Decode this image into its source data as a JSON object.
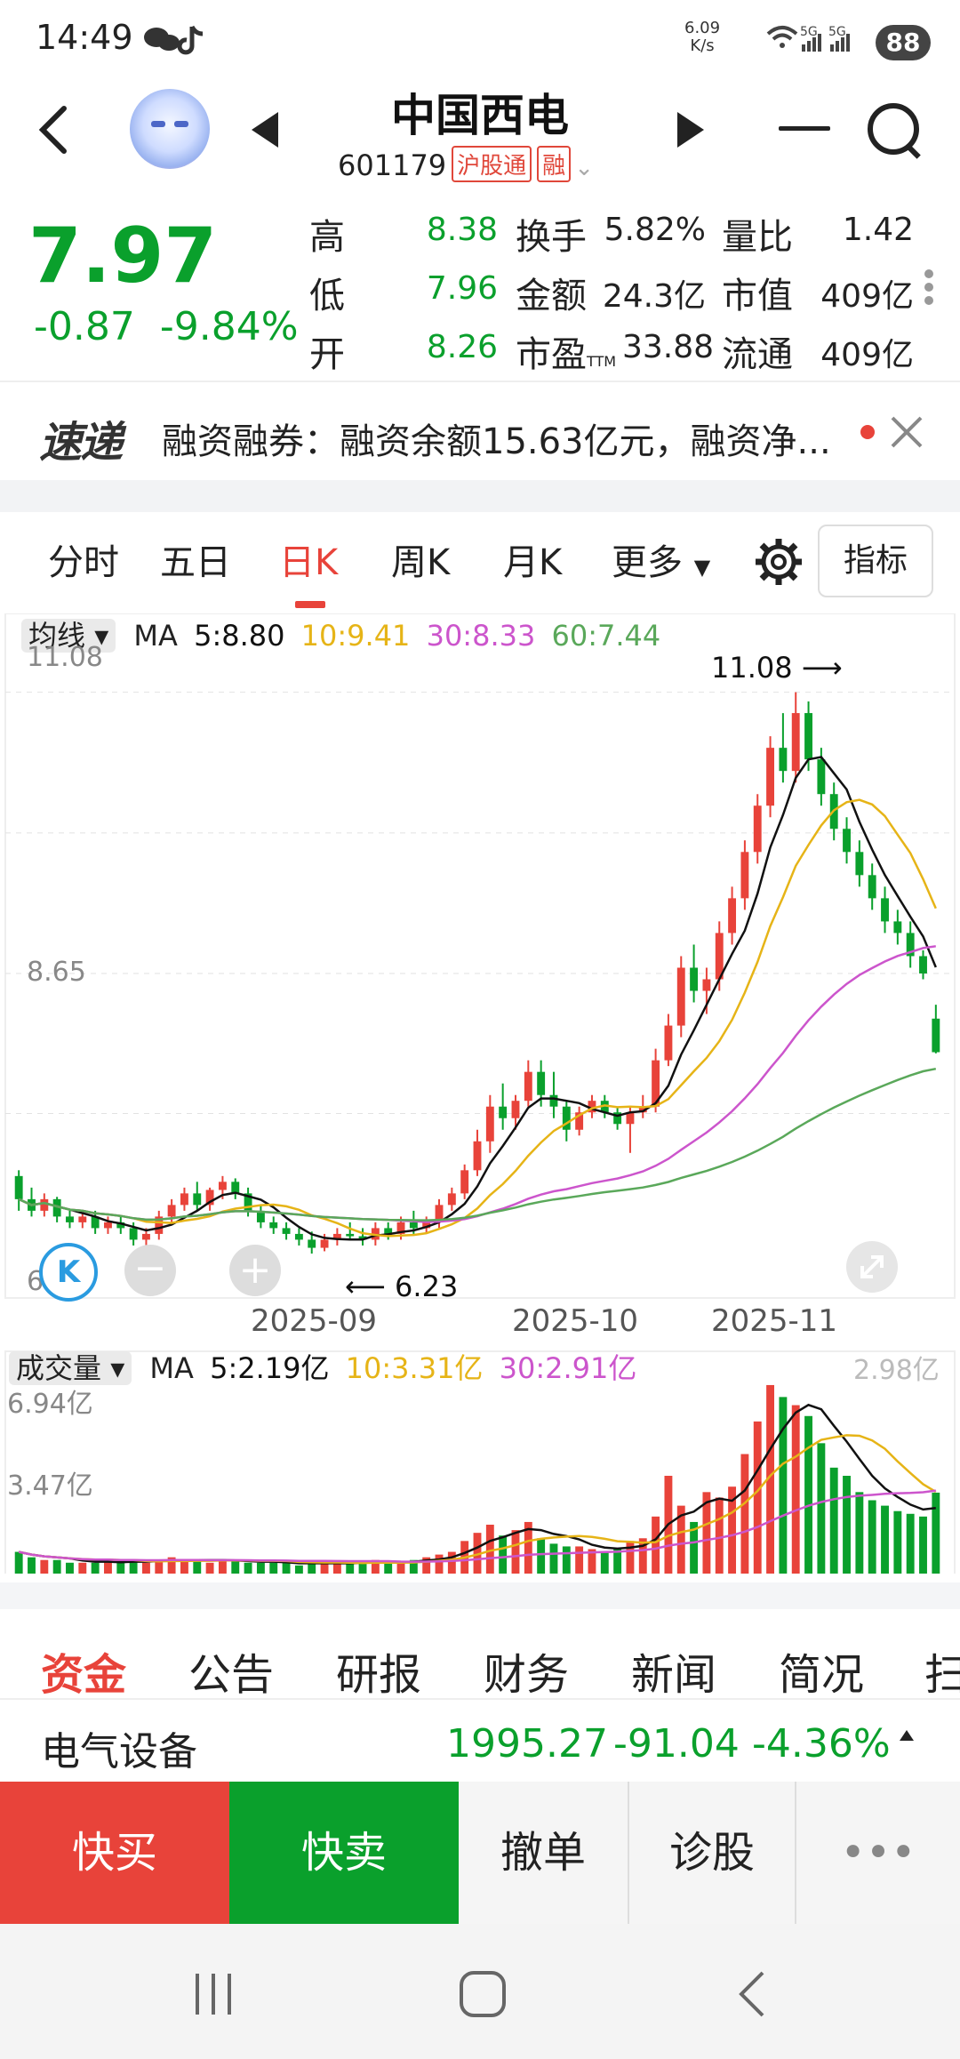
{
  "status_bar": {
    "time": "14:49",
    "net_speed": "6.09",
    "net_unit": "K/s",
    "sig1": "5G",
    "sig2": "5G",
    "battery": "88"
  },
  "header": {
    "title": "中国西电",
    "code": "601179",
    "tag1": "沪股通",
    "tag2": "融"
  },
  "quote": {
    "price": "7.97",
    "change": "-0.87",
    "change_pct": "-9.84%",
    "rows": [
      {
        "l1": "高",
        "v1": "8.38",
        "l2": "换手",
        "v2": "5.82%",
        "l3": "量比",
        "v3": "1.42"
      },
      {
        "l1": "低",
        "v1": "7.96",
        "l2": "金额",
        "v2": "24.3亿",
        "l3": "市值",
        "v3": "409亿"
      },
      {
        "l1": "开",
        "v1": "8.26",
        "l2": "市盈",
        "l2sub": "TTM",
        "v2": "33.88",
        "l3": "流通",
        "v3": "409亿"
      }
    ]
  },
  "ticker": {
    "logo": "速递",
    "text": "融资融券：融资余额15.63亿元，融资净..."
  },
  "chart_tabs": {
    "items": [
      "分时",
      "五日",
      "日K",
      "周K",
      "月K",
      "更多"
    ],
    "active": "日K",
    "indicator": "指标"
  },
  "ma_legend": {
    "selector": "均线",
    "ma": "MA",
    "ma5": "5:8.80",
    "ma10": "10:9.41",
    "ma30": "30:8.33",
    "ma60": "60:7.44"
  },
  "vol_legend": {
    "selector": "成交量",
    "ma": "MA",
    "ma5": "5:2.19亿",
    "ma10": "10:3.31亿",
    "ma30": "30:2.91亿",
    "right_val": "2.98亿"
  },
  "axis": {
    "y_high": "11.08",
    "y_mid": "8.65",
    "y_low": "6.23",
    "vol_high": "6.94亿",
    "vol_mid": "3.47亿",
    "max_label": "11.08",
    "min_label": "6.23",
    "dates": [
      "2025-09",
      "2025-10",
      "2025-11"
    ]
  },
  "bottom_tabs": {
    "items": [
      "资金",
      "公告",
      "研报",
      "财务",
      "新闻",
      "简况",
      "扫"
    ],
    "active": "资金"
  },
  "sector": {
    "name": "电气设备",
    "value": "1995.27",
    "change": "-91.04",
    "pct": "-4.36%"
  },
  "actions": {
    "buy": "快买",
    "sell": "快卖",
    "cancel": "撤单",
    "diagnose": "诊股",
    "more": "•••"
  },
  "colors": {
    "up": "#e8433a",
    "down": "#0aa02c",
    "ma5": "#111111",
    "ma10": "#e6b417",
    "ma30": "#cc55cc",
    "ma60": "#5aa85a"
  },
  "chart_data": {
    "type": "candlestick",
    "y_range": [
      6.23,
      11.08
    ],
    "x_ticks": [
      "2025-09",
      "2025-10",
      "2025-11"
    ],
    "candles": [
      [
        6.9,
        6.95,
        6.6,
        6.7
      ],
      [
        6.7,
        6.8,
        6.55,
        6.6
      ],
      [
        6.6,
        6.75,
        6.55,
        6.7
      ],
      [
        6.7,
        6.72,
        6.5,
        6.55
      ],
      [
        6.55,
        6.6,
        6.45,
        6.5
      ],
      [
        6.5,
        6.6,
        6.45,
        6.55
      ],
      [
        6.55,
        6.6,
        6.4,
        6.45
      ],
      [
        6.45,
        6.55,
        6.4,
        6.5
      ],
      [
        6.5,
        6.55,
        6.4,
        6.45
      ],
      [
        6.45,
        6.5,
        6.3,
        6.35
      ],
      [
        6.35,
        6.45,
        6.3,
        6.4
      ],
      [
        6.4,
        6.6,
        6.35,
        6.55
      ],
      [
        6.55,
        6.7,
        6.5,
        6.65
      ],
      [
        6.65,
        6.8,
        6.6,
        6.75
      ],
      [
        6.75,
        6.85,
        6.6,
        6.65
      ],
      [
        6.65,
        6.8,
        6.6,
        6.78
      ],
      [
        6.78,
        6.9,
        6.7,
        6.85
      ],
      [
        6.85,
        6.88,
        6.7,
        6.75
      ],
      [
        6.75,
        6.8,
        6.55,
        6.6
      ],
      [
        6.6,
        6.65,
        6.45,
        6.5
      ],
      [
        6.5,
        6.55,
        6.4,
        6.45
      ],
      [
        6.45,
        6.5,
        6.35,
        6.4
      ],
      [
        6.4,
        6.45,
        6.3,
        6.35
      ],
      [
        6.35,
        6.42,
        6.23,
        6.28
      ],
      [
        6.28,
        6.4,
        6.25,
        6.35
      ],
      [
        6.35,
        6.45,
        6.3,
        6.4
      ],
      [
        6.4,
        6.5,
        6.35,
        6.38
      ],
      [
        6.38,
        6.45,
        6.3,
        6.35
      ],
      [
        6.35,
        6.5,
        6.3,
        6.45
      ],
      [
        6.45,
        6.5,
        6.35,
        6.4
      ],
      [
        6.4,
        6.55,
        6.35,
        6.5
      ],
      [
        6.5,
        6.6,
        6.4,
        6.45
      ],
      [
        6.45,
        6.55,
        6.4,
        6.5
      ],
      [
        6.5,
        6.7,
        6.45,
        6.65
      ],
      [
        6.65,
        6.8,
        6.6,
        6.75
      ],
      [
        6.75,
        7.0,
        6.7,
        6.95
      ],
      [
        6.95,
        7.3,
        6.9,
        7.2
      ],
      [
        7.2,
        7.6,
        7.1,
        7.5
      ],
      [
        7.5,
        7.7,
        7.3,
        7.4
      ],
      [
        7.4,
        7.6,
        7.3,
        7.55
      ],
      [
        7.55,
        7.9,
        7.5,
        7.8
      ],
      [
        7.8,
        7.9,
        7.5,
        7.6
      ],
      [
        7.6,
        7.8,
        7.4,
        7.5
      ],
      [
        7.5,
        7.55,
        7.2,
        7.3
      ],
      [
        7.3,
        7.5,
        7.25,
        7.45
      ],
      [
        7.45,
        7.6,
        7.4,
        7.55
      ],
      [
        7.55,
        7.6,
        7.4,
        7.45
      ],
      [
        7.45,
        7.5,
        7.3,
        7.35
      ],
      [
        7.35,
        7.5,
        7.1,
        7.45
      ],
      [
        7.45,
        7.6,
        7.4,
        7.5
      ],
      [
        7.5,
        8.0,
        7.45,
        7.9
      ],
      [
        7.9,
        8.3,
        7.85,
        8.2
      ],
      [
        8.2,
        8.8,
        8.1,
        8.7
      ],
      [
        8.7,
        8.9,
        8.4,
        8.5
      ],
      [
        8.5,
        8.7,
        8.3,
        8.6
      ],
      [
        8.6,
        9.1,
        8.5,
        9.0
      ],
      [
        9.0,
        9.4,
        8.9,
        9.3
      ],
      [
        9.3,
        9.8,
        9.2,
        9.7
      ],
      [
        9.7,
        10.2,
        9.6,
        10.1
      ],
      [
        10.1,
        10.7,
        10.0,
        10.6
      ],
      [
        10.6,
        10.9,
        10.3,
        10.4
      ],
      [
        10.4,
        11.08,
        10.3,
        10.9
      ],
      [
        10.9,
        11.0,
        10.4,
        10.5
      ],
      [
        10.5,
        10.6,
        10.1,
        10.2
      ],
      [
        10.2,
        10.3,
        9.8,
        9.9
      ],
      [
        9.9,
        10.0,
        9.6,
        9.7
      ],
      [
        9.7,
        9.8,
        9.4,
        9.5
      ],
      [
        9.5,
        9.6,
        9.2,
        9.3
      ],
      [
        9.3,
        9.4,
        9.0,
        9.1
      ],
      [
        9.1,
        9.2,
        8.9,
        9.0
      ],
      [
        9.0,
        9.1,
        8.7,
        8.8
      ],
      [
        8.8,
        8.85,
        8.6,
        8.65
      ],
      [
        8.26,
        8.38,
        7.96,
        7.97
      ]
    ],
    "volume": [
      0.8,
      0.6,
      0.5,
      0.5,
      0.4,
      0.4,
      0.4,
      0.5,
      0.4,
      0.5,
      0.4,
      0.5,
      0.6,
      0.5,
      0.5,
      0.4,
      0.5,
      0.5,
      0.4,
      0.4,
      0.4,
      0.4,
      0.3,
      0.4,
      0.4,
      0.4,
      0.4,
      0.4,
      0.5,
      0.4,
      0.4,
      0.5,
      0.6,
      0.7,
      0.8,
      1.2,
      1.5,
      1.8,
      1.4,
      1.6,
      1.9,
      1.3,
      1.1,
      1.0,
      1.0,
      0.9,
      0.8,
      0.9,
      1.2,
      1.3,
      2.1,
      3.6,
      2.5,
      1.9,
      3.0,
      2.8,
      3.2,
      4.4,
      5.6,
      6.94,
      6.5,
      6.2,
      5.8,
      4.8,
      3.9,
      3.6,
      3.0,
      2.7,
      2.5,
      2.3,
      2.2,
      2.1,
      2.98
    ]
  }
}
